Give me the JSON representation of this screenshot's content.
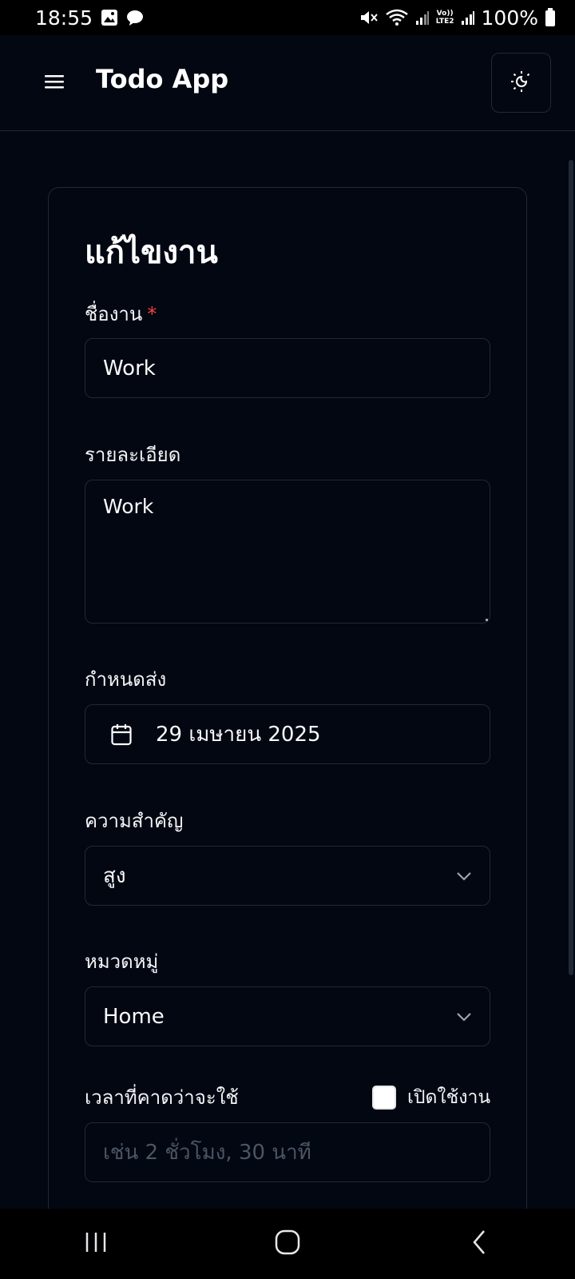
{
  "status_bar": {
    "time": "18:55",
    "battery": "100%",
    "network_tag_top": "Vo))",
    "network_tag_bottom": "LTE2"
  },
  "header": {
    "title": "Todo App",
    "menu_icon": "hamburger-menu-icon",
    "theme_icon": "sun-moon-icon"
  },
  "form": {
    "title": "แก้ไขงาน",
    "name_label": "ชื่องาน",
    "required_mark": "*",
    "name_value": "Work",
    "description_label": "รายละเอียด",
    "description_value": "Work",
    "due_label": "กำหนดส่ง",
    "due_value": "29 เมษายน 2025",
    "priority_label": "ความสำคัญ",
    "priority_value": "สูง",
    "category_label": "หมวดหมู่",
    "category_value": "Home",
    "estimate_label": "เวลาที่คาดว่าจะใช้",
    "estimate_toggle_label": "เปิดใช้งาน",
    "estimate_placeholder": "เช่น 2 ชั่วโมง, 30 นาที"
  },
  "colors": {
    "background": "#030712",
    "border": "#1f2937",
    "required": "#ef4444",
    "placeholder": "#4b5563"
  }
}
